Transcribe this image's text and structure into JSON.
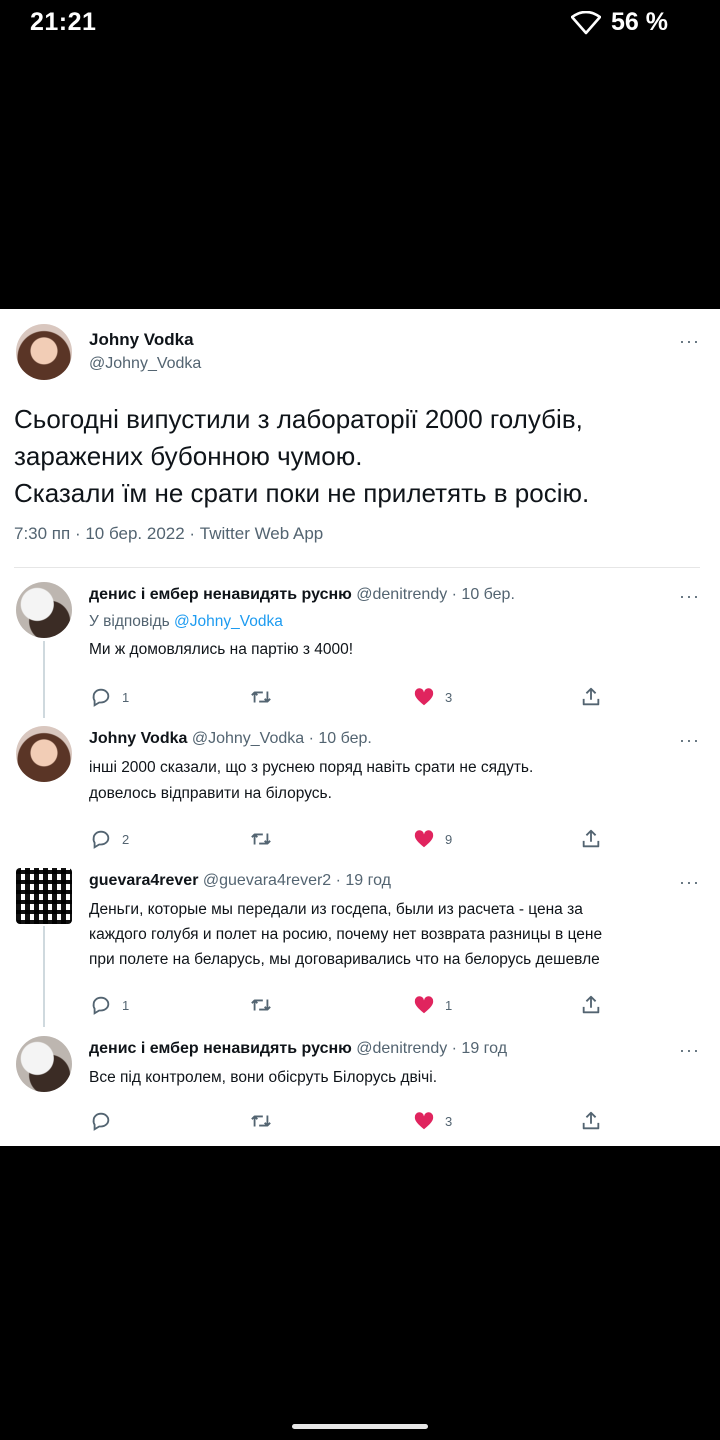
{
  "status_bar": {
    "time": "21:21",
    "battery": "56 %"
  },
  "main_tweet": {
    "name": "Johny Vodka",
    "handle": "@Johny_Vodka",
    "text_lines": [
      "Сьогодні випустили з лабораторії 2000 голубів,",
      "заражених бубонною чумою.",
      "Сказали їм не срати поки не прилетять в росію."
    ],
    "meta": "7:30 пп · 10 бер. 2022 · Twitter Web App",
    "more": "···"
  },
  "replies": [
    {
      "name": "денис і ембер ненавидять русню",
      "meta": "@denitrendy · 10 бер.",
      "reply_to_prefix": "У відповідь ",
      "reply_to_mention": "@Johny_Vodka",
      "lines": [
        "Ми ж домовлялись на партію з 4000!"
      ],
      "reply_count": "1",
      "retweet_count": "",
      "like_count": "3",
      "avatar": "dog-avatar"
    },
    {
      "name": "Johny Vodka",
      "meta": "@Johny_Vodka · 10 бер.",
      "lines": [
        "інші 2000 сказали, що з руснею поряд навіть срати не сядуть.",
        "довелось відправити на білорусь."
      ],
      "reply_count": "2",
      "retweet_count": "",
      "like_count": "9",
      "avatar": "girl-avatar"
    },
    {
      "name": "guevara4rever",
      "meta": "@guevara4rever2 · 19 год",
      "lines": [
        "Деньги, которые мы передали из госдепа, были из расчета - цена за",
        "каждого голубя и полет на росию, почему нет возврата разницы в цене",
        "при полете на беларусь, мы договаривались что на белорусь дешевле"
      ],
      "reply_count": "1",
      "retweet_count": "",
      "like_count": "1",
      "avatar": "qr-avatar"
    },
    {
      "name": "денис і ембер ненавидять русню",
      "meta": "@denitrendy · 19 год",
      "lines": [
        "Все під контролем, вони обісруть Білорусь двічі."
      ],
      "reply_count": "",
      "retweet_count": "",
      "like_count": "3",
      "avatar": "dog-avatar"
    }
  ],
  "colors": {
    "like": "#e0245e",
    "link": "#1d9bf0",
    "secondary": "#536471"
  },
  "icons": [
    "wifi-icon",
    "reply-icon",
    "retweet-icon",
    "heart-icon",
    "share-icon",
    "more-icon"
  ]
}
